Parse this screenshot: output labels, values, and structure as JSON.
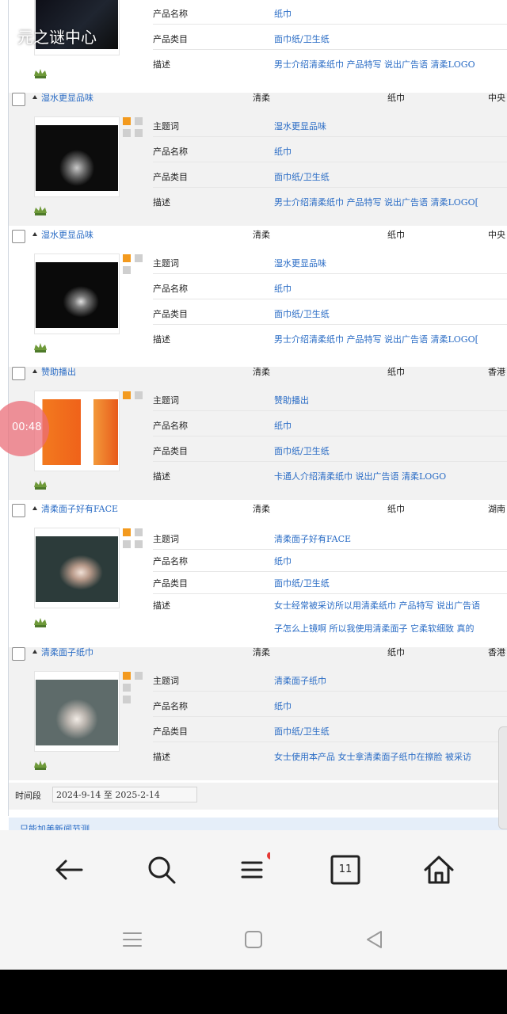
{
  "watermark": "元之谜中心",
  "timer": "00:48",
  "labels": {
    "keyword": "主题词",
    "name": "产品名称",
    "category": "产品类目",
    "desc": "描述"
  },
  "first_record": {
    "name": "纸巾",
    "category": "面巾纸/卫生纸",
    "desc": "男士介绍清柔纸巾 产品特写 说出广告语 清柔LOGO"
  },
  "records": [
    {
      "title": "湿水更显品味",
      "col1": "清柔",
      "col2": "纸巾",
      "col3": "中央",
      "keyword": "湿水更显品味",
      "name": "纸巾",
      "category": "面巾纸/卫生纸",
      "desc": "男士介绍清柔纸巾 产品特写 说出广告语 清柔LOGO["
    },
    {
      "title": "湿水更显品味",
      "col1": "清柔",
      "col2": "纸巾",
      "col3": "中央",
      "keyword": "湿水更显品味",
      "name": "纸巾",
      "category": "面巾纸/卫生纸",
      "desc": "男士介绍清柔纸巾 产品特写 说出广告语 清柔LOGO["
    },
    {
      "title": "赞助播出",
      "col1": "清柔",
      "col2": "纸巾",
      "col3": "香港",
      "keyword": "赞助播出",
      "name": "纸巾",
      "category": "面巾纸/卫生纸",
      "desc": "卡通人介绍清柔纸巾 说出广告语 清柔LOGO"
    },
    {
      "title": "清柔面子好有FACE",
      "col1": "清柔",
      "col2": "纸巾",
      "col3": "湖南",
      "keyword": "清柔面子好有FACE",
      "name": "纸巾",
      "category": "面巾纸/卫生纸",
      "desc": "女士经常被采访所以用清柔纸巾 产品特写 说出广告语",
      "desc2": "子怎么上镜啊 所以我使用清柔面子 它柔软细致 真的"
    },
    {
      "title": "清柔面子纸巾",
      "col1": "清柔",
      "col2": "纸巾",
      "col3": "香港",
      "keyword": "清柔面子纸巾",
      "name": "纸巾",
      "category": "面巾纸/卫生纸",
      "desc": "女士使用本产品 女士拿清柔面子纸巾在擦脸 被采访"
    }
  ],
  "period": {
    "label": "时间段",
    "value": "2024-9-14 至 2025-2-14"
  },
  "next_title": "只能加美新闻节测",
  "nav": {
    "tab_count": "11"
  },
  "colors": {
    "link": "#2a6cc5",
    "accent": "#f39a1e",
    "badge": "#e53935"
  }
}
